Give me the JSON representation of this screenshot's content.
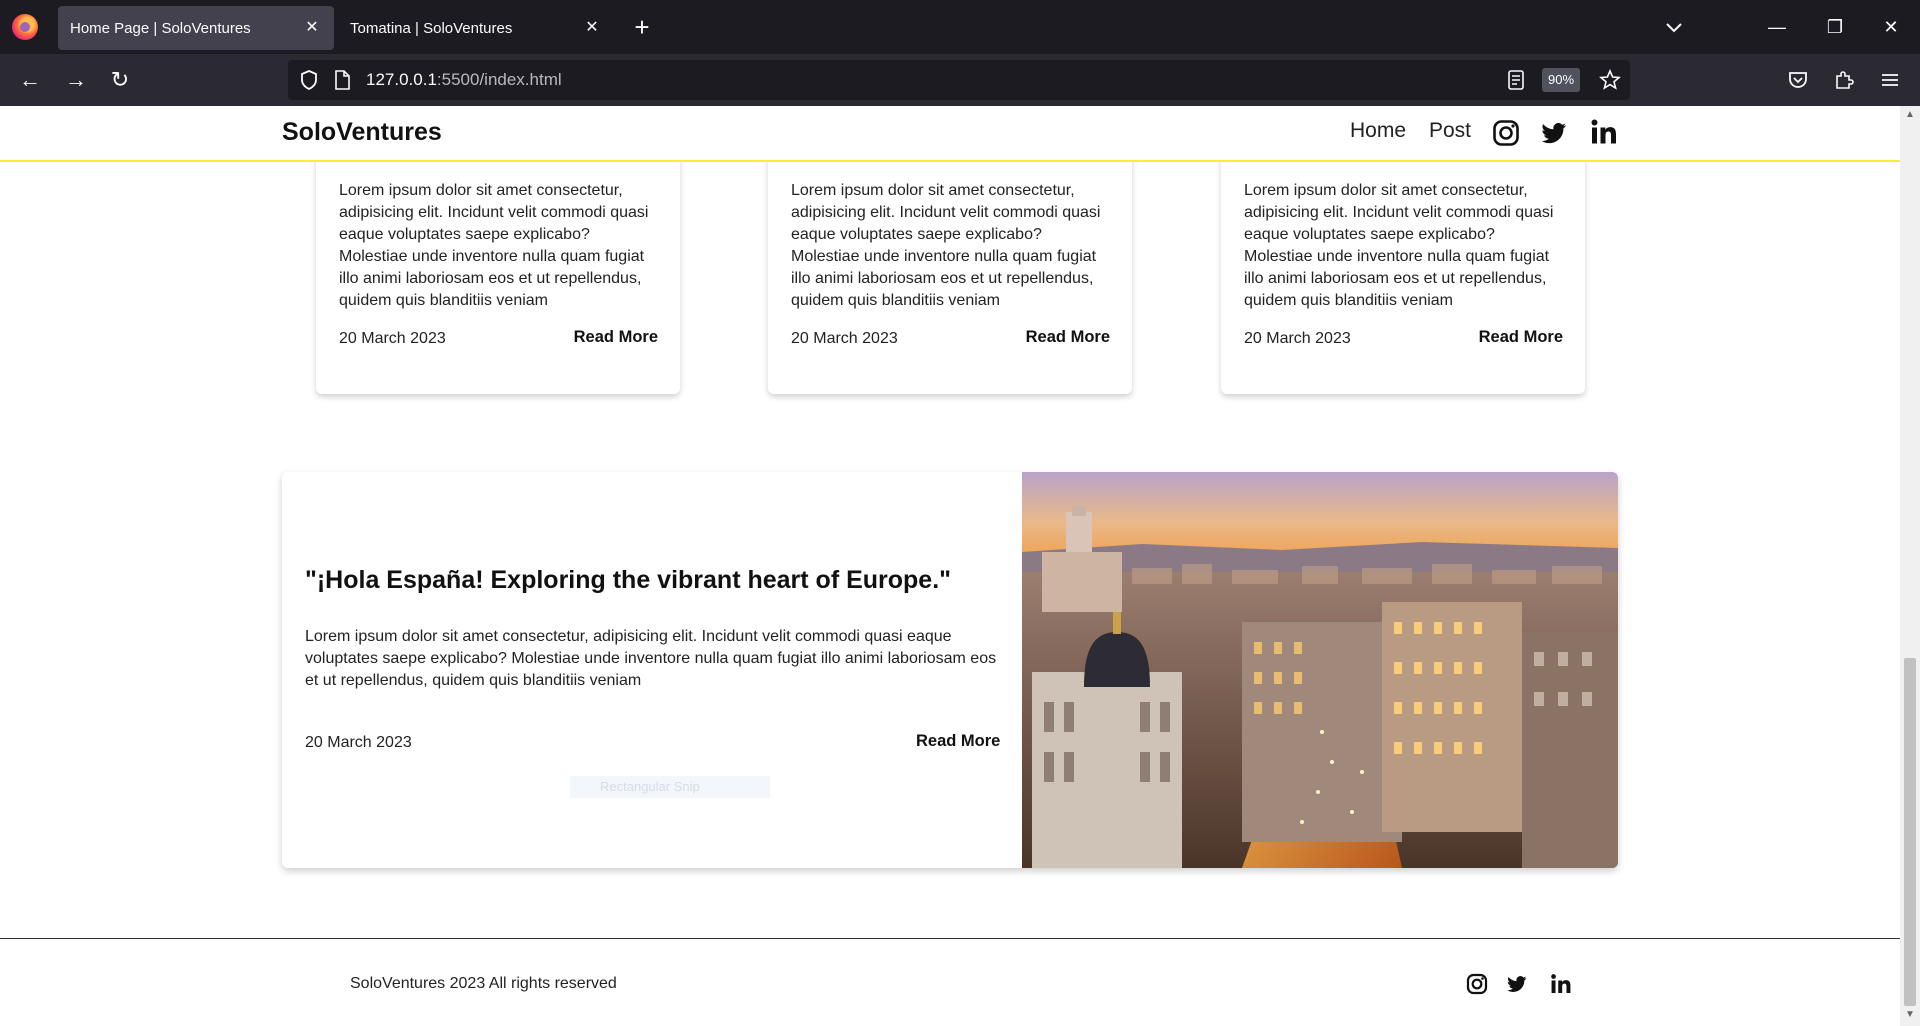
{
  "browser": {
    "tabs": [
      {
        "title": "Home Page | SoloVentures",
        "active": true
      },
      {
        "title": "Tomatina | SoloVentures",
        "active": false
      }
    ],
    "url_host": "127.0.0.1",
    "url_rest": ":5500/index.html",
    "zoom": "90%"
  },
  "site": {
    "brand": "SoloVentures",
    "nav": {
      "home": "Home",
      "post": "Post"
    },
    "accent_color": "#f5ef3b"
  },
  "cards": [
    {
      "text": "Lorem ipsum dolor sit amet consectetur, adipisicing elit. Incidunt velit commodi quasi eaque voluptates saepe explicabo? Molestiae unde inventore nulla quam fugiat illo animi laboriosam eos et ut repellendus, quidem quis blanditiis veniam",
      "date": "20 March 2023",
      "read_more": "Read More"
    },
    {
      "text": "Lorem ipsum dolor sit amet consectetur, adipisicing elit. Incidunt velit commodi quasi eaque voluptates saepe explicabo? Molestiae unde inventore nulla quam fugiat illo animi laboriosam eos et ut repellendus, quidem quis blanditiis veniam",
      "date": "20 March 2023",
      "read_more": "Read More"
    },
    {
      "text": "Lorem ipsum dolor sit amet consectetur, adipisicing elit. Incidunt velit commodi quasi eaque voluptates saepe explicabo? Molestiae unde inventore nulla quam fugiat illo animi laboriosam eos et ut repellendus, quidem quis blanditiis veniam",
      "date": "20 March 2023",
      "read_more": "Read More"
    }
  ],
  "feature": {
    "title": "\"¡Hola España! Exploring the vibrant heart of Europe.\"",
    "text": "Lorem ipsum dolor sit amet consectetur, adipisicing elit. Incidunt velit commodi quasi eaque voluptates saepe explicabo? Molestiae unde inventore nulla quam fugiat illo animi laboriosam eos et ut repellendus, quidem quis blanditiis veniam",
    "date": "20 March 2023",
    "read_more": "Read More",
    "ghost_label": "Rectangular Snip"
  },
  "footer": {
    "text": "SoloVentures 2023 All rights reserved"
  }
}
